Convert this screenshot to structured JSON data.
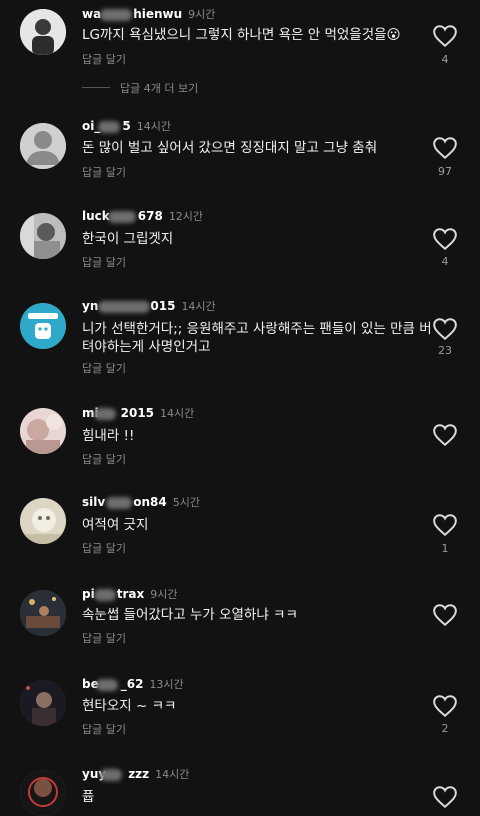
{
  "reply_label": "답글 달기",
  "more_replies": "답글 4개 더 보기",
  "comments": [
    {
      "user_a": "wa",
      "user_b": "hienwu",
      "time": "9시간",
      "text": "LG까지 욕심냈으니 그렇지 하나면 욕은 안 먹었을것을😮",
      "likes": "4"
    },
    {
      "user_a": "oi_",
      "user_b": "5",
      "time": "14시간",
      "text": "돈 많이 벌고 싶어서 갔으면 징징대지 말고 그냥 춤춰",
      "likes": "97"
    },
    {
      "user_a": "luck",
      "user_b": "678",
      "time": "12시간",
      "text": "한국이 그립겟지",
      "likes": "4"
    },
    {
      "user_a": "yn",
      "user_b": "015",
      "time": "14시간",
      "text": "니가 선택한거다;; 응원해주고 사랑해주는 팬들이 있는 만큼 버텨야하는게 사명인거고",
      "likes": "23"
    },
    {
      "user_a": "mi",
      "user_b": "2015",
      "time": "14시간",
      "text": "힘내라 !!",
      "likes": ""
    },
    {
      "user_a": "silv",
      "user_b": "on84",
      "time": "5시간",
      "text": "여적여 긋지",
      "likes": "1"
    },
    {
      "user_a": "pi",
      "user_b": "trax",
      "time": "9시간",
      "text": "속눈썹 들어갔다고 누가 오열하냐 ㅋㅋ",
      "likes": ""
    },
    {
      "user_a": "be",
      "user_b": "_62",
      "time": "13시간",
      "text": "현타오지 ~ ㅋㅋ",
      "likes": "2"
    },
    {
      "user_a": "yuy",
      "user_b": "zzz",
      "time": "14시간",
      "text": "퓹",
      "likes": ""
    }
  ]
}
